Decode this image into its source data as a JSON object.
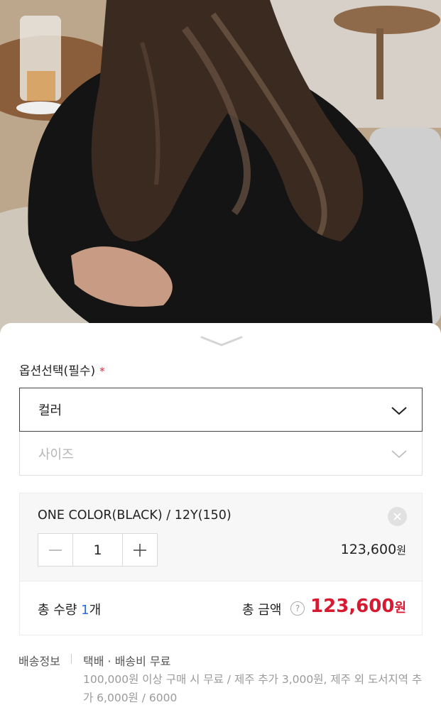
{
  "photo": {
    "description_icon": "product-photo"
  },
  "sheet": {
    "option_title": "옵션선택(필수)",
    "required_mark": "*",
    "selects": [
      {
        "label": "컬러",
        "state": "selected"
      },
      {
        "label": "사이즈",
        "state": "disabled"
      }
    ]
  },
  "item": {
    "name": "ONE COLOR(BLACK) / 12Y(150)",
    "quantity": "1",
    "price": "123,600",
    "currency": "원"
  },
  "total": {
    "qty_label": "총 수량 ",
    "qty_value": "1",
    "qty_unit": "개",
    "amount_label": "총 금액",
    "help": "?",
    "amount": "123,600",
    "currency": "원"
  },
  "shipping": {
    "label": "배송정보",
    "value": "택배 · 배송비 무료",
    "detail": "100,000원 이상 구매 시 무료 / 제주 추가 3,000원, 제주 외 도서지역 추가 6,000원 / 6000"
  },
  "colors": {
    "accent_red": "#d71a32",
    "accent_blue": "#2f6bd8"
  }
}
